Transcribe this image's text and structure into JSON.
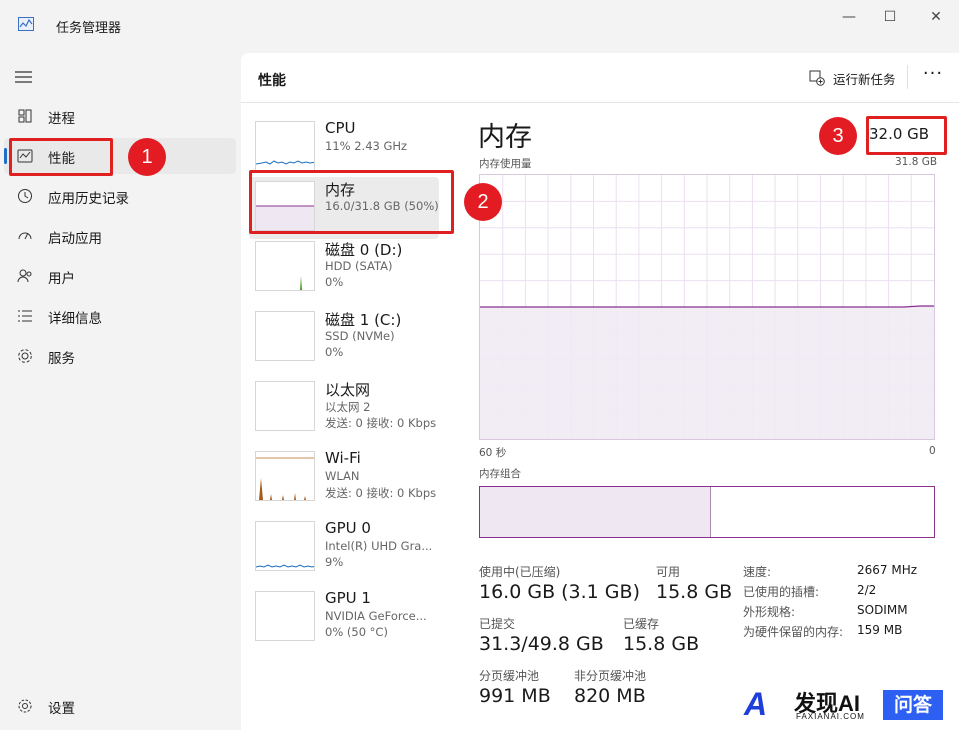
{
  "window": {
    "title": "任务管理器",
    "minimize": "—",
    "maximize": "☐",
    "close": "✕"
  },
  "sidebar": {
    "items": [
      {
        "label": "进程",
        "icon": "processes-icon"
      },
      {
        "label": "性能",
        "icon": "performance-icon",
        "active": true
      },
      {
        "label": "应用历史记录",
        "icon": "history-icon"
      },
      {
        "label": "启动应用",
        "icon": "startup-icon"
      },
      {
        "label": "用户",
        "icon": "users-icon"
      },
      {
        "label": "详细信息",
        "icon": "details-icon"
      },
      {
        "label": "服务",
        "icon": "services-icon"
      }
    ],
    "settings": "设置"
  },
  "header": {
    "title": "性能",
    "run_task": "运行新任务",
    "more": "···"
  },
  "devices": [
    {
      "name": "CPU",
      "line1": "11% 2.43 GHz",
      "line2": ""
    },
    {
      "name": "内存",
      "line1": "16.0/31.8 GB (50%)",
      "line2": ""
    },
    {
      "name": "磁盘 0 (D:)",
      "line1": "HDD (SATA)",
      "line2": "0%"
    },
    {
      "name": "磁盘 1 (C:)",
      "line1": "SSD (NVMe)",
      "line2": "0%"
    },
    {
      "name": "以太网",
      "line1": "以太网 2",
      "line2": "发送: 0 接收: 0 Kbps"
    },
    {
      "name": "Wi-Fi",
      "line1": "WLAN",
      "line2": "发送: 0 接收: 0 Kbps"
    },
    {
      "name": "GPU 0",
      "line1": "Intel(R) UHD Gra...",
      "line2": "9%"
    },
    {
      "name": "GPU 1",
      "line1": "NVIDIA GeForce...",
      "line2": "0% (50 °C)"
    }
  ],
  "detail": {
    "title": "内存",
    "total": "32.0 GB",
    "usage_label": "内存使用量",
    "usage_max": "31.8 GB",
    "time_left": "60 秒",
    "time_right": "0",
    "usage_fraction": 0.5,
    "composition_label": "内存组合",
    "composition_in_use_fraction": 0.5,
    "stats": {
      "in_use_label": "使用中(已压缩)",
      "in_use_value": "16.0 GB (3.1 GB)",
      "available_label": "可用",
      "available_value": "15.8 GB",
      "committed_label": "已提交",
      "committed_value": "31.3/49.8 GB",
      "cached_label": "已缓存",
      "cached_value": "15.8 GB",
      "paged_label": "分页缓冲池",
      "paged_value": "991 MB",
      "nonpaged_label": "非分页缓冲池",
      "nonpaged_value": "820 MB"
    },
    "specs": {
      "speed_label": "速度:",
      "speed_value": "2667 MHz",
      "slots_label": "已使用的插槽:",
      "slots_value": "2/2",
      "form_label": "外形规格:",
      "form_value": "SODIMM",
      "reserved_label": "为硬件保留的内存:",
      "reserved_value": "159 MB"
    }
  },
  "annotations": {
    "badge1": "1",
    "badge2": "2",
    "badge3": "3"
  },
  "watermark": {
    "brand": "发现AI",
    "sub": "FAXIANAI.COM",
    "tag": "问答"
  },
  "colors": {
    "accent": "#1f6ec9",
    "memory": "#8a2f8f",
    "annotation": "#e31b23"
  }
}
